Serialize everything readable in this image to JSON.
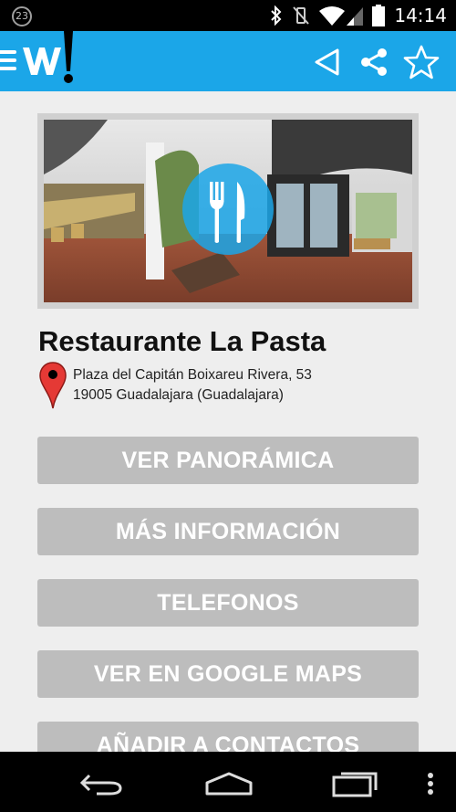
{
  "status_bar": {
    "notification_count": "23",
    "time": "14:14",
    "icons": [
      "bluetooth-icon",
      "vibrate-off-icon",
      "wifi-icon",
      "cell-signal-icon",
      "battery-icon"
    ]
  },
  "app_bar": {
    "color": "#1ba6e8",
    "icons": [
      "menu-icon",
      "logo-icon",
      "back-triangle-icon",
      "share-icon",
      "star-outline-icon"
    ]
  },
  "place": {
    "image_icon": "fork-knife-icon",
    "title": "Restaurante La Pasta",
    "address_line1": "Plaza del Capitán Boixareu Rivera, 53",
    "address_line2": "19005 Guadalajara (Guadalajara)"
  },
  "buttons": {
    "panoramic": "VER PANORÁMICA",
    "more_info": "MÁS INFORMACIÓN",
    "phones": "TELEFONOS",
    "google_maps": "VER EN GOOGLE MAPS",
    "add_contacts": "AÑADIR A CONTACTOS"
  },
  "colors": {
    "button_bg": "#bdbdbd",
    "accent": "#1ba6e8"
  }
}
